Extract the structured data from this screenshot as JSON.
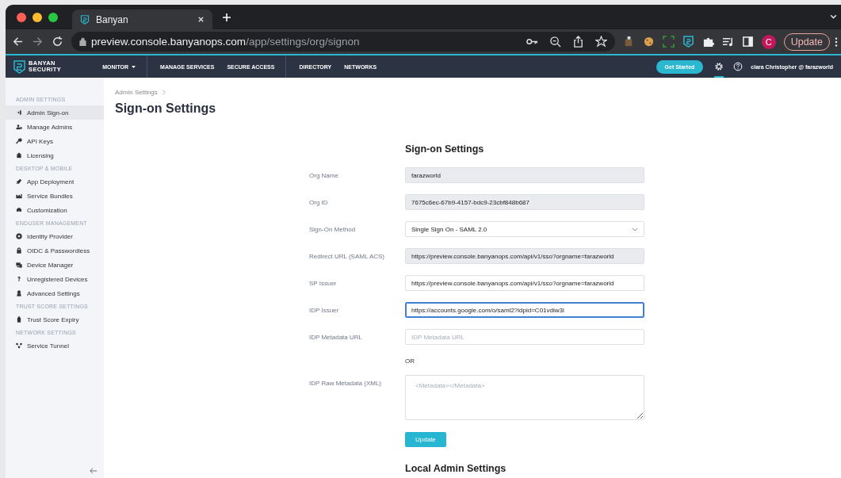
{
  "browser": {
    "tab": {
      "title": "Banyan",
      "selected": true
    },
    "url_host": "preview.console.banyanops.com",
    "url_path": "/app/settings/org/signon",
    "profile_initial": "C",
    "update_button": "Update"
  },
  "nav": {
    "brand": [
      "BANYAN",
      "SECURITY"
    ],
    "menu": [
      {
        "label": "MONITOR",
        "dropdown": true,
        "divider_after": true
      },
      {
        "label": "MANAGE SERVICES",
        "dropdown": false,
        "divider_after": false
      },
      {
        "label": "SECURE ACCESS",
        "dropdown": false,
        "divider_after": true
      },
      {
        "label": "DIRECTORY",
        "dropdown": false,
        "divider_after": false
      },
      {
        "label": "NETWORKS",
        "dropdown": false,
        "divider_after": false
      }
    ],
    "get_started": "Get Started",
    "settings_selected": true,
    "user": "clara Christopher @ farazworld"
  },
  "sidebar": {
    "sections": [
      {
        "title": "ADMIN SETTINGS",
        "items": [
          {
            "label": "Admin Sign-on",
            "selected": true
          },
          {
            "label": "Manage Admins",
            "selected": false
          },
          {
            "label": "API Keys",
            "selected": false
          },
          {
            "label": "Licensing",
            "selected": false
          }
        ]
      },
      {
        "title": "DESKTOP & MOBILE",
        "items": [
          {
            "label": "App Deployment",
            "selected": false
          },
          {
            "label": "Service Bundles",
            "selected": false
          },
          {
            "label": "Customization",
            "selected": false
          }
        ]
      },
      {
        "title": "ENDUSER MANAGEMENT",
        "items": [
          {
            "label": "Identity Provider",
            "selected": false
          },
          {
            "label": "OIDC & Passwordless",
            "selected": false
          },
          {
            "label": "Device Manager",
            "selected": false
          },
          {
            "label": "Unregistered Devices",
            "selected": false
          },
          {
            "label": "Advanced Settings",
            "selected": false
          }
        ]
      },
      {
        "title": "TRUST SCORE SETTINGS",
        "items": [
          {
            "label": "Trust Score Expiry",
            "selected": false
          }
        ]
      },
      {
        "title": "NETWORK SETTINGS",
        "items": [
          {
            "label": "Service Tunnel",
            "selected": false
          }
        ]
      }
    ]
  },
  "breadcrumb": "Admin Settings",
  "page_title": "Sign-on Settings",
  "form": {
    "heading": "Sign-on Settings",
    "fields": [
      {
        "kind": "readonly",
        "label": "Org Name",
        "value": "farazworld"
      },
      {
        "kind": "readonly",
        "label": "Org ID",
        "value": "7675c6ec-67b9-4157-bdc9-23cbf848b687"
      },
      {
        "kind": "select",
        "label": "Sign-On Method",
        "value": "Single Sign On - SAML 2.0"
      },
      {
        "kind": "readonly",
        "label": "Redirect URL (SAML ACS)",
        "value": "https://preview.console.banyanops.com/api/v1/sso?orgname=farazworld"
      },
      {
        "kind": "text",
        "label": "SP Issuer",
        "value": "https://preview.console.banyanops.com/api/v1/sso?orgname=farazworld",
        "focused": false
      },
      {
        "kind": "text",
        "label": "IDP Issuer",
        "value": "https://accounts.google.com/o/saml2?idpid=C01vdiw3l",
        "focused": true
      },
      {
        "kind": "text",
        "label": "IDP Metadata URL",
        "placeholder": "IDP Metadata URL",
        "focused": false
      },
      {
        "kind": "separator",
        "text": "OR"
      },
      {
        "kind": "textarea",
        "label": "IDP Raw Metadata (XML)",
        "placeholder": "<Metadata></Metadata>"
      }
    ],
    "submit": "Update"
  },
  "next_heading": "Local Admin Settings"
}
